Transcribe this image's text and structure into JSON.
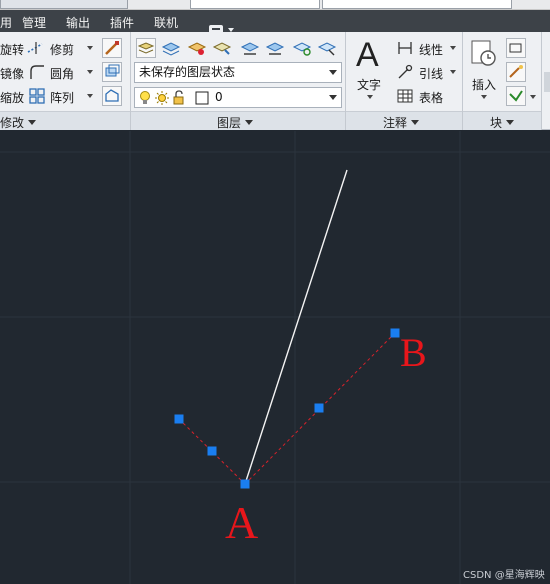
{
  "menu": {
    "items": [
      "用",
      "管理",
      "输出",
      "插件",
      "联机"
    ]
  },
  "ribbon": {
    "modify": {
      "rotate_label": "旋转",
      "trim_label": "修剪",
      "mirror_label": "镜像",
      "fillet_label": "圆角",
      "scale_label": "缩放",
      "array_label": "阵列",
      "panel_title": "修改"
    },
    "layers": {
      "layer_state": "未保存的图层状态",
      "current_layer": "0",
      "panel_title": "图层"
    },
    "annotation": {
      "text_label": "文字",
      "dimension_label": "线性",
      "leader_label": "引线",
      "table_label": "表格",
      "panel_title": "注释"
    },
    "block": {
      "insert_label": "插入",
      "panel_title": "块"
    }
  },
  "canvas": {
    "point_a_label": "A",
    "point_b_label": "B",
    "label_color": "#e8161b",
    "grip_color": "#1a7ef0",
    "dash_color": "#d9222a",
    "line_color": "#f4f4f4"
  },
  "watermark": "CSDN @星海辉映"
}
